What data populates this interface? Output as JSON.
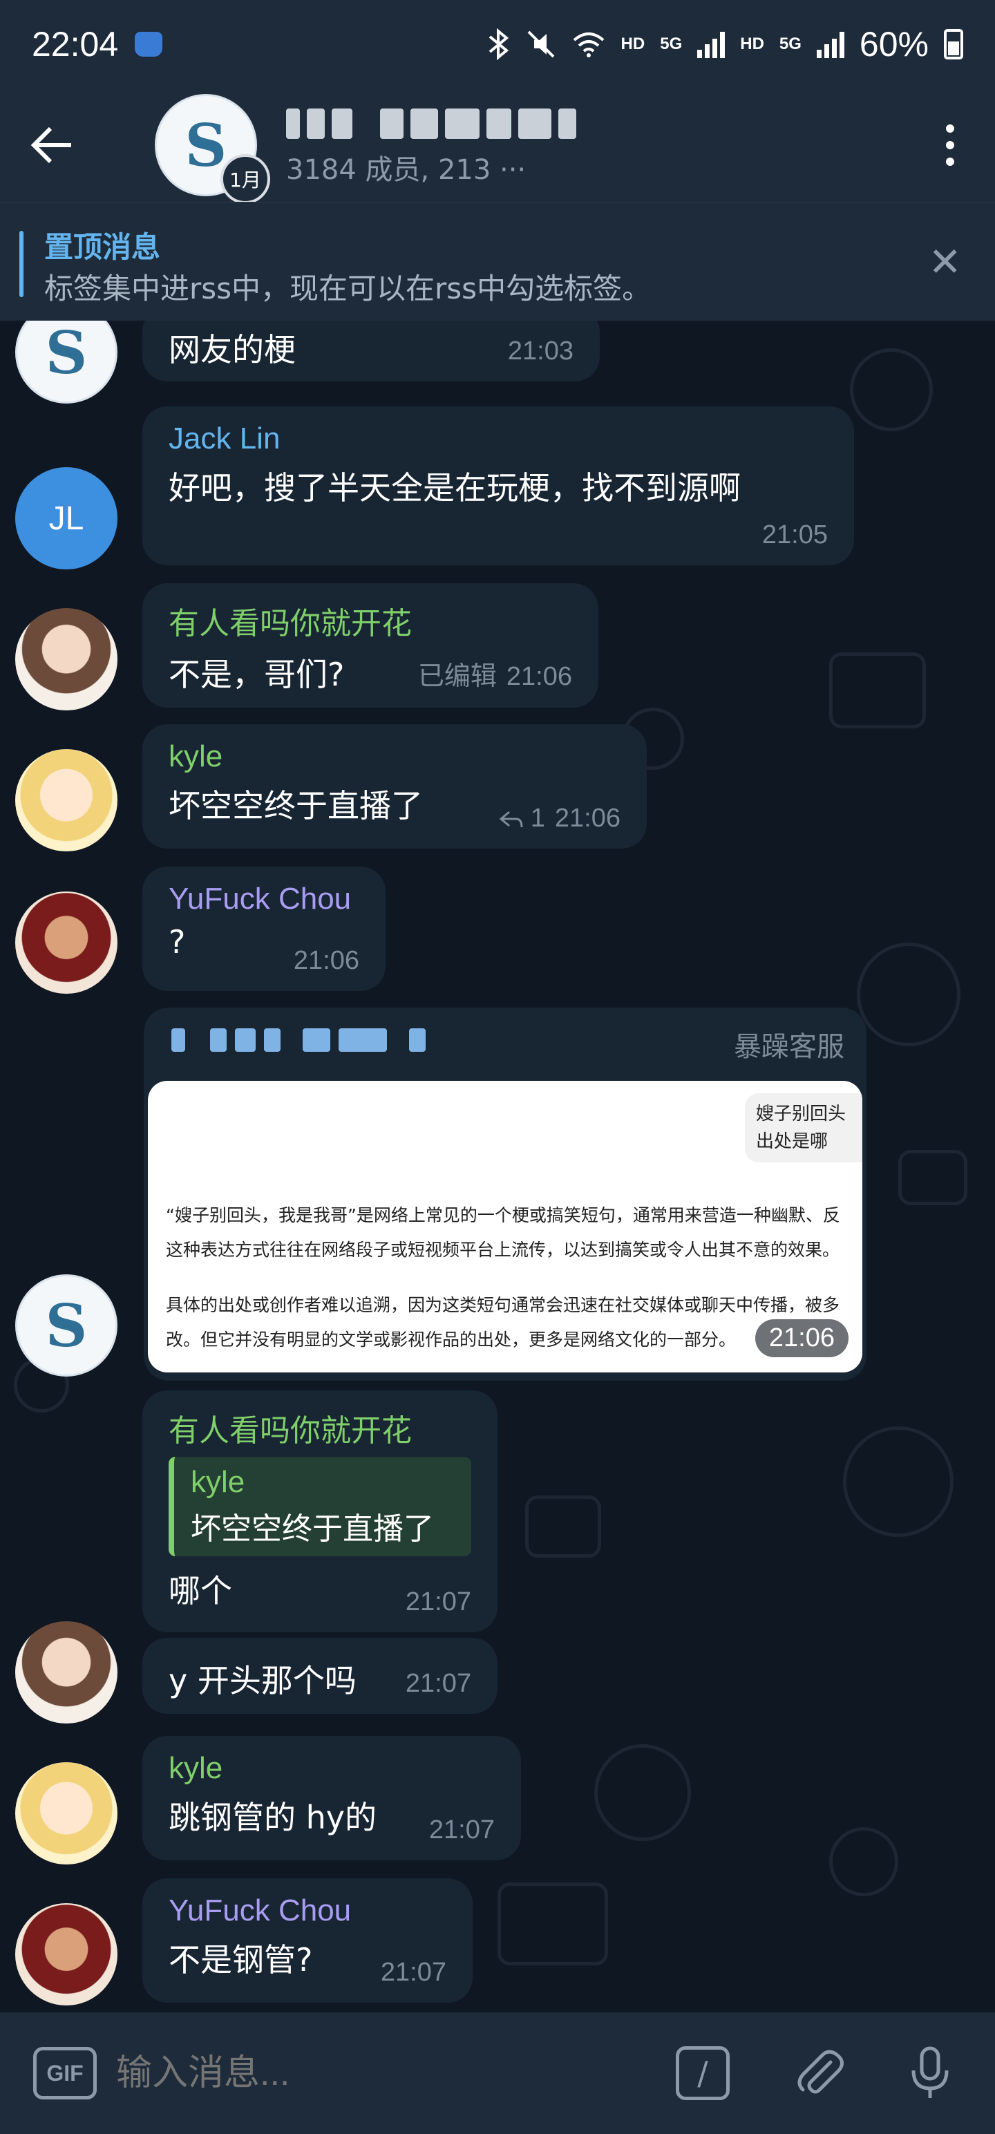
{
  "status_bar": {
    "time": "22:04",
    "network_1": "HD",
    "network_2": "5G",
    "network_3": "HD",
    "network_4": "5G",
    "battery": "60%"
  },
  "header": {
    "back_icon": "arrow-left-icon",
    "title": "S···2.0",
    "subtitle": "3184 成员, 213 ···",
    "avatar_badge": "1月",
    "menu_icon": "more-vertical-icon"
  },
  "pinned": {
    "title": "置顶消息",
    "text": "标签集中进rss中，现在可以在rss中勾选标签。",
    "close_icon": "close-icon"
  },
  "messages": [
    {
      "text": "网友的梗",
      "time": "21:03"
    },
    {
      "name": "Jack Lin",
      "text": "好吧，搜了半天全是在玩梗，找不到源啊",
      "time": "21:05",
      "avatar": "JL"
    },
    {
      "name": "有人看吗你就开花",
      "text": "不是，哥们?",
      "edited": "已编辑",
      "time": "21:06"
    },
    {
      "name": "kyle",
      "text": "坏空空终于直播了",
      "reply_count": "1",
      "time": "21:06"
    },
    {
      "name": "YuFuck Chou",
      "text": "?",
      "time": "21:06"
    },
    {
      "admin": "暴躁客服",
      "time": "21:06",
      "shot_chip": "嫂子别回头\n出处是哪",
      "shot_lines": [
        "“嫂子别回头，我是我哥”是网络上常见的一个梗或搞笑短句，通常用来营造一种幽默、反",
        "这种表达方式往往在网络段子或短视频平台上流传，以达到搞笑或令人出其不意的效果。",
        "具体的出处或创作者难以追溯，因为这类短句通常会迅速在社交媒体或聊天中传播，被多",
        "改。但它并没有明显的文学或影视作品的出处，更多是网络文化的一部分。"
      ]
    },
    {
      "name": "有人看吗你就开花",
      "quote_name": "kyle",
      "quote_text": "坏空空终于直播了",
      "text": "哪个",
      "time": "21:07"
    },
    {
      "text": "y 开头那个吗",
      "time": "21:07"
    },
    {
      "name": "kyle",
      "text": "跳钢管的 hy的",
      "time": "21:07"
    },
    {
      "name": "YuFuck Chou",
      "text": "不是钢管?",
      "time": "21:07"
    }
  ],
  "input": {
    "gif_label": "GIF",
    "placeholder": "输入消息...",
    "command_label": "/"
  }
}
